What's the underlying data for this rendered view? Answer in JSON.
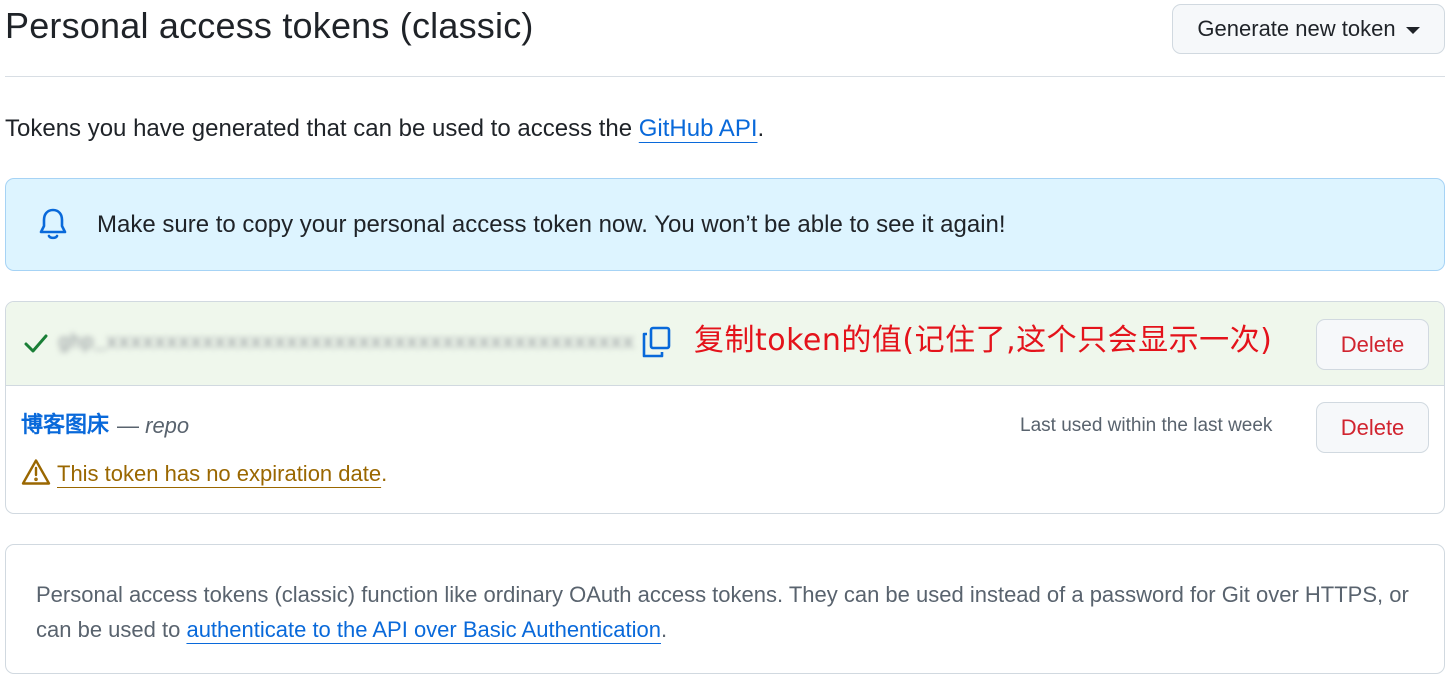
{
  "header": {
    "title": "Personal access tokens (classic)",
    "generate_button": "Generate new token"
  },
  "intro": {
    "text": "Tokens you have generated that can be used to access the ",
    "link": "GitHub API",
    "suffix": "."
  },
  "flash": {
    "icon": "bell-icon",
    "message": "Make sure to copy your personal access token now. You won’t be able to see it again!"
  },
  "new_token": {
    "status_icon": "check-icon",
    "value": "ghp_xxxxxxxxxxxxxxxxxxxxxxxxxxxxxxxxxxxxxxxxxxxxxxxxx",
    "copy_icon": "copy-icon",
    "annotation": "复制token的值(记住了,这个只会显示一次)",
    "delete_label": "Delete"
  },
  "tokens": [
    {
      "name": "博客图床",
      "separator": " — ",
      "scope": "repo",
      "last_used": "Last used within the last week",
      "warning_icon": "alert-icon",
      "warning_link": "This token has no expiration date",
      "warning_suffix": ".",
      "delete_label": "Delete"
    }
  ],
  "info": {
    "text": "Personal access tokens (classic) function like ordinary OAuth access tokens. They can be used instead of a password for Git over HTTPS, or can be used to ",
    "link": "authenticate to the API over Basic Authentication",
    "suffix": "."
  },
  "colors": {
    "link": "#0969da",
    "danger": "#d1242f",
    "warning": "#9a6700",
    "success": "#1a7f37",
    "flash_bg": "#ddf4ff",
    "new_token_bg": "#eff7ec",
    "annotation": "#e4131b"
  }
}
